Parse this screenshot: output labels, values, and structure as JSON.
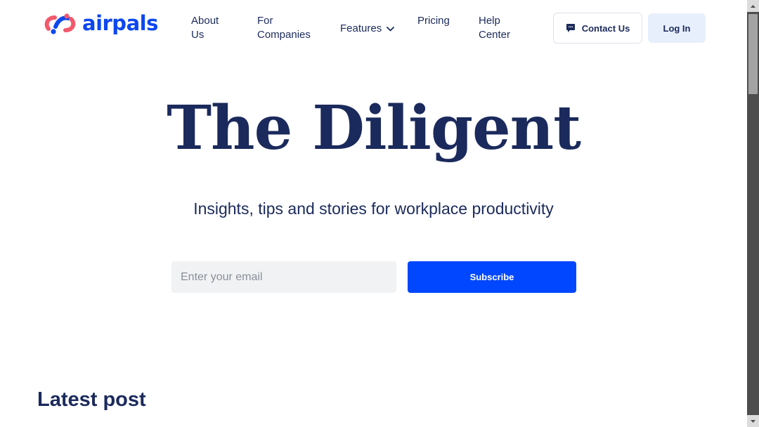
{
  "brand": {
    "name": "airpals",
    "color": "#0d47f0",
    "accent": "#f25a6c"
  },
  "nav": {
    "about": "About Us",
    "companies": "For Companies",
    "features": "Features",
    "pricing": "Pricing",
    "help": "Help Center"
  },
  "actions": {
    "contact": "Contact Us",
    "login": "Log In"
  },
  "hero": {
    "title": "The Diligent",
    "subtitle": "Insights, tips and stories for workplace productivity",
    "email_placeholder": "Enter your email",
    "email_value": "",
    "subscribe": "Subscribe"
  },
  "sections": {
    "latest": "Latest post"
  },
  "colors": {
    "primary": "#0047ff",
    "text": "#1b2a5c",
    "login_bg": "#e8effc"
  },
  "icons": [
    "chat-icon",
    "chevron-down-icon",
    "scroll-up-arrow-icon",
    "scroll-down-arrow-icon"
  ]
}
